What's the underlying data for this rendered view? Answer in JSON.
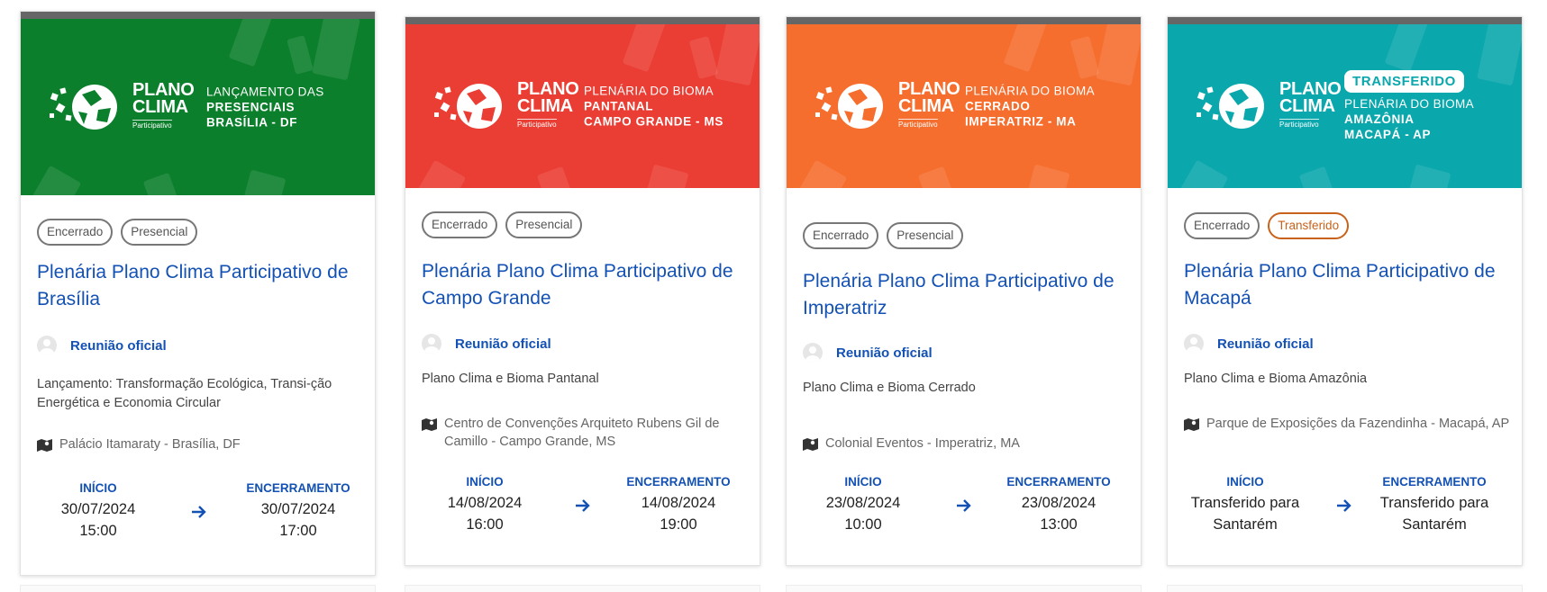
{
  "cards": [
    {
      "banner": {
        "color": "#0b7f2b",
        "logo_line1": "PLANO",
        "logo_line2": "CLIMA",
        "logo_sub": "Participativo",
        "text_line1": "LANÇAMENTO DAS",
        "text_line2": "PRESENCIAIS",
        "text_line3": "BRASÍLIA - DF"
      },
      "tags": [
        "Encerrado",
        "Presencial"
      ],
      "title": "Plenária Plano Clima Participativo de Brasília",
      "organizer": "Reunião oficial",
      "description": "Lançamento: Transformação Ecológica, Transi-ção Energética e Economia Circular",
      "location": "Palácio Itamaraty - Brasília, DF",
      "start_label": "INÍCIO",
      "start_line1": "30/07/2024",
      "start_line2": "15:00",
      "end_label": "ENCERRAMENTO",
      "end_line1": "30/07/2024",
      "end_line2": "17:00"
    },
    {
      "banner": {
        "color": "#ea3d33",
        "logo_line1": "PLANO",
        "logo_line2": "CLIMA",
        "logo_sub": "Participativo",
        "text_line1": "PLENÁRIA DO BIOMA",
        "text_line2": "PANTANAL",
        "text_line3": "CAMPO GRANDE - MS"
      },
      "tags": [
        "Encerrado",
        "Presencial"
      ],
      "title": "Plenária Plano Clima Participativo de Campo Grande",
      "organizer": "Reunião oficial",
      "description": "Plano Clima e Bioma Pantanal",
      "location": "Centro de Convenções Arquiteto Rubens Gil de Camillo - Campo Grande, MS",
      "start_label": "INÍCIO",
      "start_line1": "14/08/2024",
      "start_line2": "16:00",
      "end_label": "ENCERRAMENTO",
      "end_line1": "14/08/2024",
      "end_line2": "19:00"
    },
    {
      "banner": {
        "color": "#f56e2e",
        "logo_line1": "PLANO",
        "logo_line2": "CLIMA",
        "logo_sub": "Participativo",
        "text_line1": "PLENÁRIA DO BIOMA",
        "text_line2": "CERRADO",
        "text_line3": "IMPERATRIZ - MA"
      },
      "tags": [
        "Encerrado",
        "Presencial"
      ],
      "title": "Plenária Plano Clima Participativo de Imperatriz",
      "organizer": "Reunião oficial",
      "description": "Plano Clima e Bioma Cerrado",
      "location": "Colonial Eventos - Imperatriz, MA",
      "start_label": "INÍCIO",
      "start_line1": "23/08/2024",
      "start_line2": "10:00",
      "end_label": "ENCERRAMENTO",
      "end_line1": "23/08/2024",
      "end_line2": "13:00"
    },
    {
      "banner": {
        "color": "#0aa7ac",
        "badge": "TRANSFERIDO",
        "logo_line1": "PLANO",
        "logo_line2": "CLIMA",
        "logo_sub": "Participativo",
        "text_line1": "PLENÁRIA DO BIOMA",
        "text_line2": "AMAZÔNIA",
        "text_line3": "MACAPÁ - AP"
      },
      "tags": [
        "Encerrado",
        "Transferido"
      ],
      "title": "Plenária Plano Clima Participativo de Macapá",
      "organizer": "Reunião oficial",
      "description": "Plano Clima e Bioma Amazônia",
      "location": "Parque de Exposições da Fazendinha - Macapá, AP",
      "start_label": "INÍCIO",
      "start_line1": "Transferido para",
      "start_line2": "Santarém",
      "end_label": "ENCERRAMENTO",
      "end_line1": "Transferido para",
      "end_line2": "Santarém"
    }
  ],
  "colors": {
    "link_blue": "#1351b4",
    "transferred_tag": "#c8621a"
  }
}
